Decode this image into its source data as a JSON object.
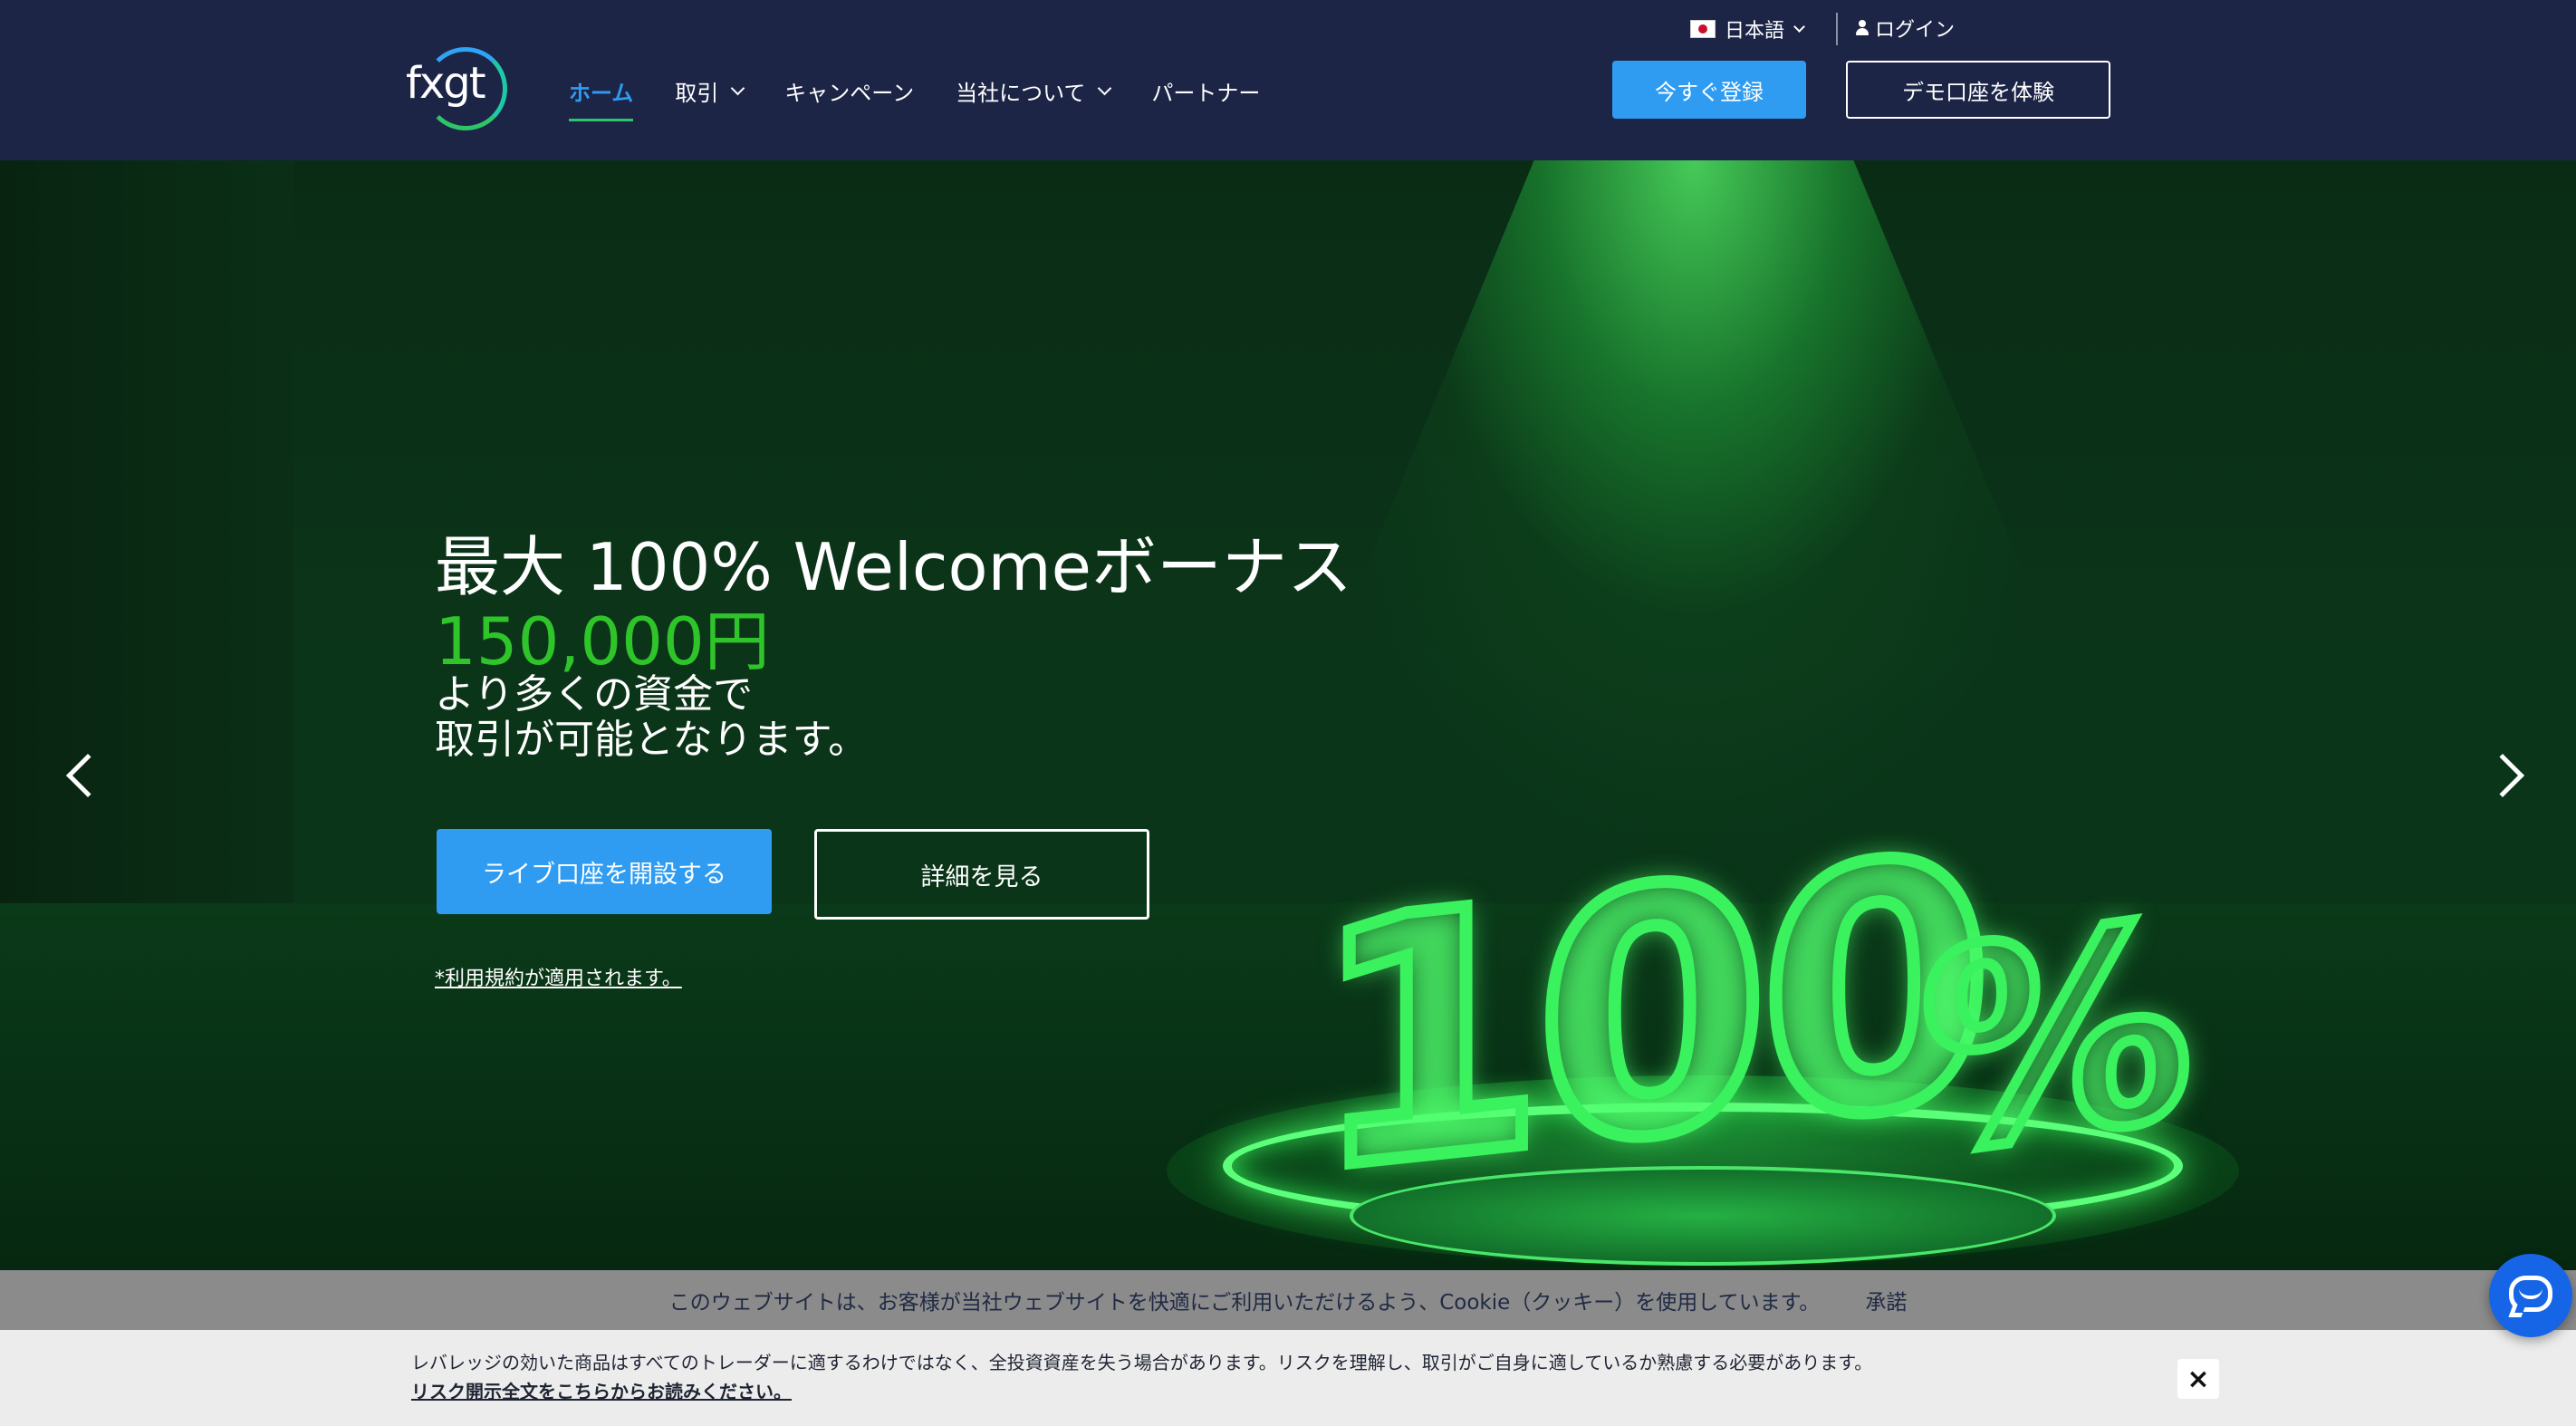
{
  "header": {
    "logo_text": "fxgt",
    "nav": [
      {
        "label": "ホーム",
        "active": true,
        "dropdown": false
      },
      {
        "label": "取引",
        "active": false,
        "dropdown": true
      },
      {
        "label": "キャンペーン",
        "active": false,
        "dropdown": false
      },
      {
        "label": "当社について",
        "active": false,
        "dropdown": true
      },
      {
        "label": "パートナー",
        "active": false,
        "dropdown": false
      }
    ],
    "language": "日本語",
    "login": "ログイン",
    "register_button": "今すぐ登録",
    "demo_button": "デモ口座を体験"
  },
  "hero": {
    "title": "最大 100% Welcomeボーナス",
    "amount": "150,000円",
    "subtitle_line1": "より多くの資金で",
    "subtitle_line2": "取引が可能となります。",
    "live_account_button": "ライブ口座を開設する",
    "details_button": "詳細を見る",
    "terms_link": "*利用規約が適用されます。",
    "graphic_text": "100",
    "graphic_percent": "%"
  },
  "cookie": {
    "text": "このウェブサイトは、お客様が当社ウェブサイトを快適にご利用いただけるよう、Cookie（クッキー）を使用しています。",
    "accept": "承諾"
  },
  "risk": {
    "text": "レバレッジの効いた商品はすべてのトレーダーに適するわけではなく、全投資資産を失う場合があります。リスクを理解し、取引がご自身に適しているか熟慮する必要があります。",
    "link": "リスク開示全文をこちらからお読みください。",
    "close": "×"
  },
  "colors": {
    "header_bg": "#1d2547",
    "accent_blue": "#2f9cf2",
    "amount_green": "#2ec42a",
    "neon_green": "#3af25e"
  },
  "icons": {
    "flag": "japan-flag-icon",
    "login": "person-icon",
    "prev": "chevron-left-icon",
    "next": "chevron-right-icon",
    "chat": "chat-icon"
  }
}
